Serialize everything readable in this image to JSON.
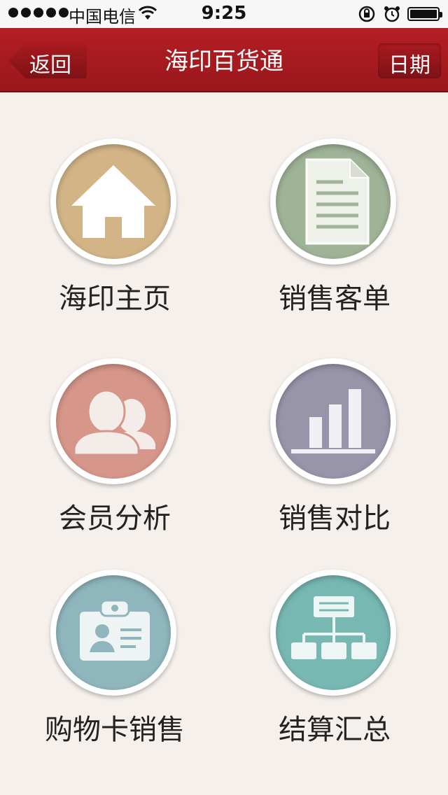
{
  "status_bar": {
    "carrier": "中国电信",
    "time": "9:25"
  },
  "nav": {
    "back_label": "返回",
    "title": "海印百货通",
    "date_label": "日期"
  },
  "menu": [
    {
      "label": "海印主页",
      "icon": "home-icon",
      "color": "#d2b487"
    },
    {
      "label": "销售客单",
      "icon": "document-icon",
      "color": "#9fb397"
    },
    {
      "label": "会员分析",
      "icon": "members-icon",
      "color": "#d6968a"
    },
    {
      "label": "销售对比",
      "icon": "bar-chart-icon",
      "color": "#9895aa"
    },
    {
      "label": "购物卡销售",
      "icon": "id-card-icon",
      "color": "#8fb6bd"
    },
    {
      "label": "结算汇总",
      "icon": "org-chart-icon",
      "color": "#78b8b3"
    }
  ]
}
